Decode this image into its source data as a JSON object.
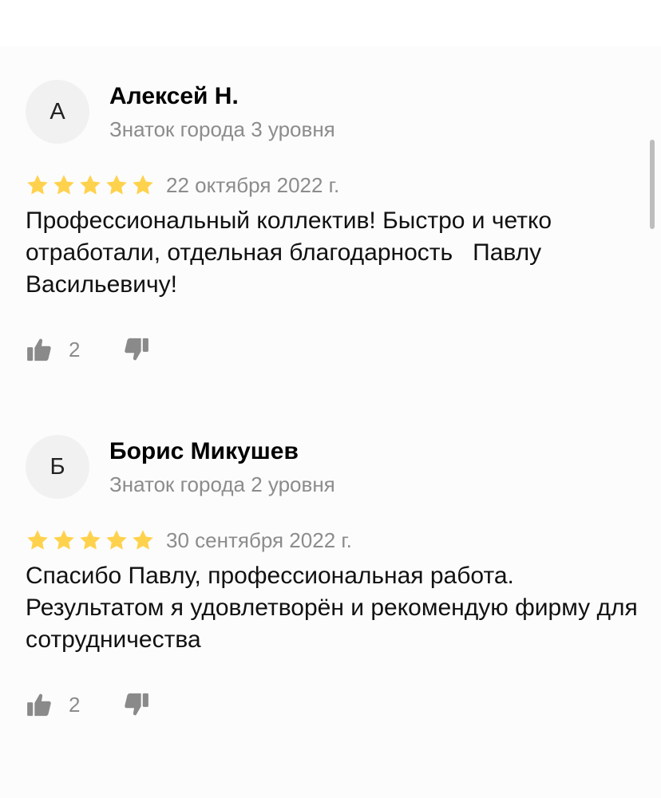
{
  "colors": {
    "star": "#ffd24e",
    "secondary_text": "#8c8c8c",
    "thumb_icon": "#8a8a8a"
  },
  "reviews": [
    {
      "avatar_letter": "А",
      "author": "Алексей Н.",
      "level": "Знаток города 3 уровня",
      "rating": 5,
      "date": "22 октября 2022 г.",
      "text": "Профессиональный коллектив! Быстро и четко отработали, отдельная благодарность   Павлу Васильевичу!",
      "likes": "2",
      "like_icon": "thumbs-up-icon",
      "dislike_icon": "thumbs-down-icon"
    },
    {
      "avatar_letter": "Б",
      "author": "Борис Микушев",
      "level": "Знаток города 2 уровня",
      "rating": 5,
      "date": "30 сентября 2022 г.",
      "text": "Спасибо Павлу, профессиональная работа. Результатом я удовлетворён и рекомендую фирму для сотрудничества",
      "likes": "2",
      "like_icon": "thumbs-up-icon",
      "dislike_icon": "thumbs-down-icon"
    }
  ]
}
